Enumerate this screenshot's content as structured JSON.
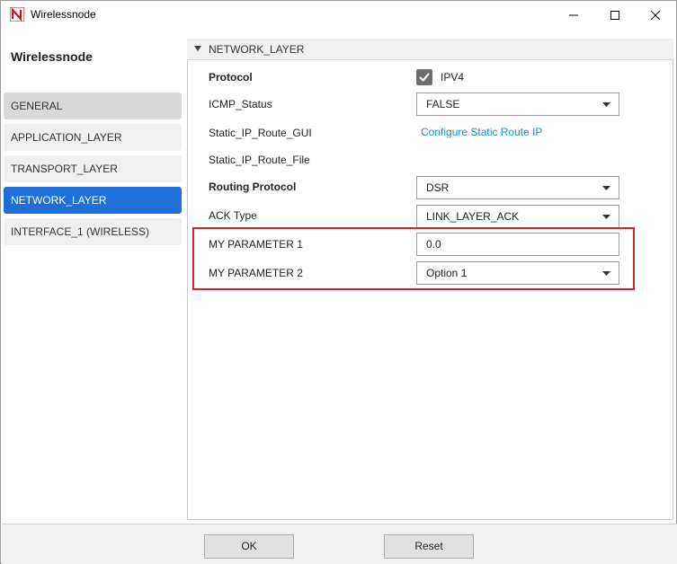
{
  "window": {
    "title": "Wirelessnode",
    "icon": "netsim-logo-icon",
    "controls": [
      "minimize-icon",
      "maximize-icon",
      "close-icon"
    ]
  },
  "sidebar": {
    "title": "Wirelessnode",
    "items": [
      {
        "label": "GENERAL",
        "state": "hover"
      },
      {
        "label": "APPLICATION_LAYER",
        "state": "normal"
      },
      {
        "label": "TRANSPORT_LAYER",
        "state": "normal"
      },
      {
        "label": "NETWORK_LAYER",
        "state": "selected"
      },
      {
        "label": "INTERFACE_1 (WIRELESS)",
        "state": "normal"
      }
    ]
  },
  "section": {
    "title": "NETWORK_LAYER",
    "rows": {
      "protocol": {
        "label": "Protocol",
        "checkbox_label": "IPV4",
        "checked": true
      },
      "icmp_status": {
        "label": "ICMP_Status",
        "value": "FALSE"
      },
      "static_ip_route_gui": {
        "label": "Static_IP_Route_GUI",
        "link": "Configure Static Route IP"
      },
      "static_ip_route_file": {
        "label": "Static_IP_Route_File"
      },
      "routing_protocol": {
        "label": "Routing Protocol",
        "value": "DSR"
      },
      "ack_type": {
        "label": "ACK Type",
        "value": "LINK_LAYER_ACK"
      },
      "my_parameter_1": {
        "label": "MY PARAMETER 1",
        "value": "0.0"
      },
      "my_parameter_2": {
        "label": "MY PARAMETER 2",
        "value": "Option 1"
      }
    }
  },
  "footer": {
    "ok_label": "OK",
    "reset_label": "Reset"
  },
  "colors": {
    "accent": "#1e6fd9",
    "link": "#1a8cc8",
    "highlight": "#d0252e"
  }
}
